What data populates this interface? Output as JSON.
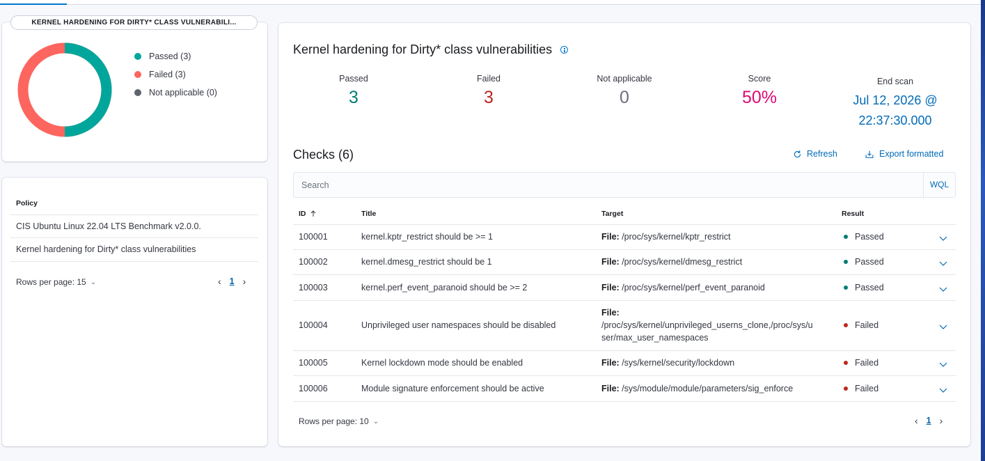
{
  "summary": {
    "badge": "KERNEL HARDENING FOR DIRTY* CLASS VULNERABILI...",
    "legend": [
      {
        "label": "Passed (3)",
        "color": "#00a69b"
      },
      {
        "label": "Failed (3)",
        "color": "#fc665f"
      },
      {
        "label": "Not applicable (0)",
        "color": "#5e646f"
      }
    ],
    "counts": {
      "passed": 3,
      "failed": 3,
      "not_applicable": 0
    }
  },
  "policies": {
    "header": "Policy",
    "rows": [
      "CIS Ubuntu Linux 22.04 LTS Benchmark v2.0.0.",
      "Kernel hardening for Dirty* class vulnerabilities"
    ],
    "rows_per_page": "Rows per page: 15",
    "page": "1"
  },
  "main": {
    "title": "Kernel hardening for Dirty* class vulnerabilities",
    "stats": {
      "passed_label": "Passed",
      "passed_value": "3",
      "failed_label": "Failed",
      "failed_value": "3",
      "na_label": "Not applicable",
      "na_value": "0",
      "score_label": "Score",
      "score_value": "50%",
      "end_scan_label": "End scan",
      "end_scan_date": "Jul 12, 2026 @",
      "end_scan_time": "22:37:30.000"
    },
    "colors": {
      "passed": "#017d73",
      "failed": "#bd271e",
      "na": "#69707d",
      "score": "#dd0a73",
      "link": "#006bb8"
    },
    "checks_title": "Checks (6)",
    "refresh_label": "Refresh",
    "export_label": "Export formatted",
    "search_placeholder": "Search",
    "wql_label": "WQL",
    "columns": {
      "id": "ID",
      "title": "Title",
      "target": "Target",
      "result": "Result"
    },
    "rows": [
      {
        "id": "100001",
        "title": "kernel.kptr_restrict should be >= 1",
        "target_label": "File:",
        "target": "/proc/sys/kernel/kptr_restrict",
        "result": "Passed"
      },
      {
        "id": "100002",
        "title": "kernel.dmesg_restrict should be 1",
        "target_label": "File:",
        "target": "/proc/sys/kernel/dmesg_restrict",
        "result": "Passed"
      },
      {
        "id": "100003",
        "title": "kernel.perf_event_paranoid should be >= 2",
        "target_label": "File:",
        "target": "/proc/sys/kernel/perf_event_paranoid",
        "result": "Passed"
      },
      {
        "id": "100004",
        "title": "Unprivileged user namespaces should be disabled",
        "target_label": "File:",
        "target_line1": "/proc/sys/kernel/unprivileged_userns_clone,/proc/sys/u",
        "target_line2": "ser/max_user_namespaces",
        "result": "Failed"
      },
      {
        "id": "100005",
        "title": "Kernel lockdown mode should be enabled",
        "target_label": "File:",
        "target": "/sys/kernel/security/lockdown",
        "result": "Failed"
      },
      {
        "id": "100006",
        "title": "Module signature enforcement should be active",
        "target_label": "File:",
        "target": "/sys/module/module/parameters/sig_enforce",
        "result": "Failed"
      }
    ],
    "rows_per_page": "Rows per page: 10",
    "page": "1"
  }
}
